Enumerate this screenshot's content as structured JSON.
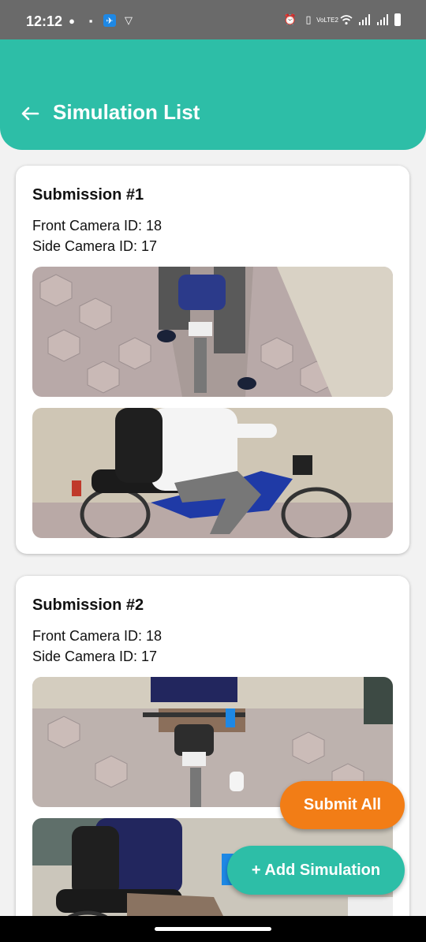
{
  "status_bar": {
    "time": "12:12",
    "left_icons": [
      "message-icon",
      "lock-icon",
      "app-icon",
      "vpn-icon"
    ],
    "right_icons": [
      "alarm-icon",
      "vibrate-icon",
      "volte-icon",
      "wifi-icon",
      "signal-icon",
      "signal-icon",
      "battery-icon"
    ],
    "volte_label": "VoLTE2"
  },
  "app_bar": {
    "title": "Simulation List",
    "back_icon": "back-arrow-icon",
    "color": "#2dbea7"
  },
  "submissions": [
    {
      "title": "Submission #1",
      "front_camera": "Front Camera ID: 18",
      "side_camera": "Side Camera ID: 17",
      "front_image": "front-camera-photo",
      "side_image": "side-camera-photo"
    },
    {
      "title": "Submission #2",
      "front_camera": "Front Camera ID: 18",
      "side_camera": "Side Camera ID: 17",
      "front_image": "front-camera-photo",
      "side_image": "side-camera-photo"
    }
  ],
  "actions": {
    "submit_all": "Submit All",
    "add_simulation": "+ Add Simulation",
    "submit_color": "#f27d16",
    "add_color": "#2dbea7"
  }
}
